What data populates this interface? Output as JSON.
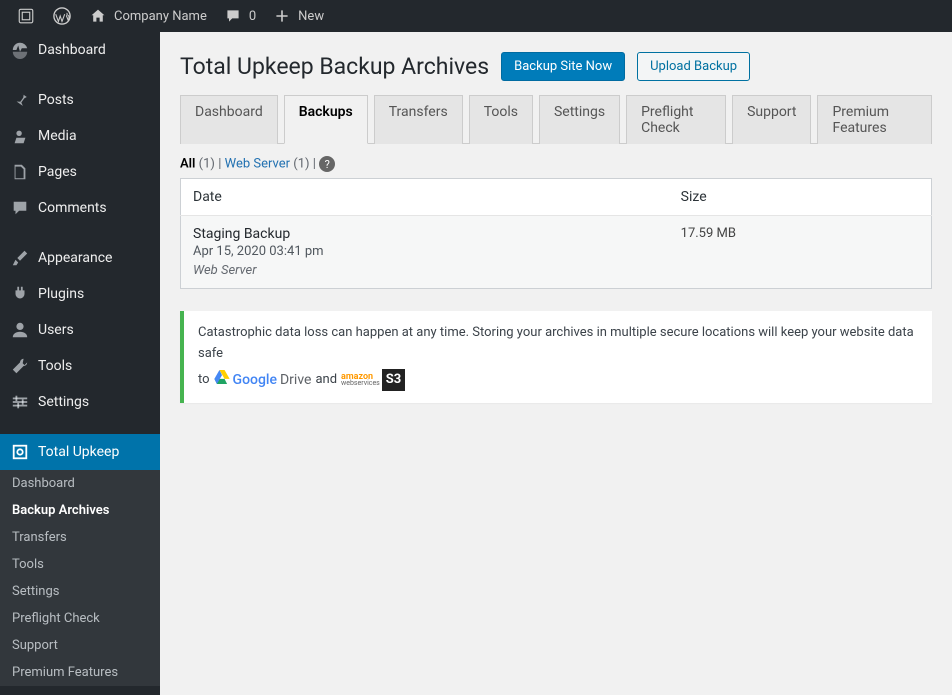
{
  "adminbar": {
    "site_name": "Company Name",
    "comment_count": "0",
    "new_label": "New"
  },
  "sidebar": {
    "items": [
      {
        "label": "Dashboard",
        "icon": "dashboard"
      },
      {
        "label": "Posts",
        "icon": "pin"
      },
      {
        "label": "Media",
        "icon": "media"
      },
      {
        "label": "Pages",
        "icon": "page"
      },
      {
        "label": "Comments",
        "icon": "comment"
      },
      {
        "label": "Appearance",
        "icon": "brush"
      },
      {
        "label": "Plugins",
        "icon": "plugin"
      },
      {
        "label": "Users",
        "icon": "user"
      },
      {
        "label": "Tools",
        "icon": "tools"
      },
      {
        "label": "Settings",
        "icon": "settings"
      },
      {
        "label": "Total Upkeep",
        "icon": "upkeep"
      }
    ],
    "submenu": [
      "Dashboard",
      "Backup Archives",
      "Transfers",
      "Tools",
      "Settings",
      "Preflight Check",
      "Support",
      "Premium Features"
    ]
  },
  "page": {
    "title": "Total Upkeep Backup Archives",
    "backup_now": "Backup Site Now",
    "upload_backup": "Upload Backup"
  },
  "tabs": [
    "Dashboard",
    "Backups",
    "Transfers",
    "Tools",
    "Settings",
    "Preflight Check",
    "Support",
    "Premium Features"
  ],
  "filter": {
    "all_label": "All",
    "all_count": "(1)",
    "webserver_label": "Web Server",
    "webserver_count": "(1)"
  },
  "table": {
    "col_date": "Date",
    "col_size": "Size",
    "rows": [
      {
        "name": "Staging Backup",
        "date": "Apr 15, 2020 03:41 pm",
        "location": "Web Server",
        "size": "17.59 MB"
      }
    ]
  },
  "notice": {
    "text_pre": "Catastrophic data loss can happen at any time. Storing your archives in multiple secure locations will keep your website data safe",
    "text_to": "to",
    "google": "Google",
    "drive": "Drive",
    "and": "and",
    "amazon": "amazon",
    "webservices": "webservices",
    "s3": "S3"
  }
}
